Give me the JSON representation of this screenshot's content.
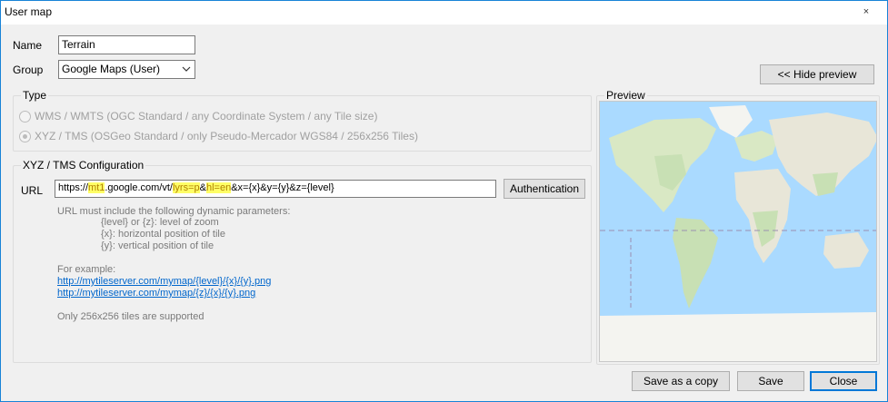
{
  "window": {
    "title": "User map",
    "close_glyph": "×"
  },
  "form": {
    "name_label": "Name",
    "name_value": "Terrain",
    "group_label": "Group",
    "group_value": "Google Maps (User)"
  },
  "hide_preview_label": "<< Hide preview",
  "type_group": {
    "legend": "Type",
    "options": [
      {
        "label": "WMS / WMTS (OGC Standard / any Coordinate System / any Tile size)",
        "checked": false,
        "enabled": false
      },
      {
        "label": "XYZ / TMS (OSGeo Standard / only Pseudo-Mercador WGS84 / 256x256 Tiles)",
        "checked": true,
        "enabled": false
      }
    ]
  },
  "xyz_group": {
    "legend": "XYZ / TMS Configuration",
    "url_label": "URL",
    "url_parts": {
      "p1": "https://",
      "p2": "mt1",
      "p3": ".google.com/vt/",
      "p4": "lyrs=p",
      "p5": "&",
      "p6": "hl=en",
      "p7": "&x={x}&y={y}&z={level}"
    },
    "auth_label": "Authentication",
    "help_lines": [
      "URL must include the following dynamic parameters:",
      "{level} or {z}: level of zoom",
      "{x}: horizontal position of tile",
      "{y}: vertical position of tile"
    ],
    "example_label": "For example:",
    "examples": [
      "http://mytileserver.com/mymap/{level}/{x}/{y}.png",
      "http://mytileserver.com/mymap/{z}/{x}/{y}.png"
    ],
    "note": "Only 256x256 tiles are supported"
  },
  "preview": {
    "legend": "Preview"
  },
  "buttons": {
    "save_copy": "Save as a copy",
    "save": "Save",
    "close": "Close"
  },
  "colors": {
    "ocean": "#aadaff",
    "land": "#e8e6d8",
    "vegetation": "#c8e0b4",
    "accent": "#0078d7",
    "highlight": "#ffff66"
  }
}
